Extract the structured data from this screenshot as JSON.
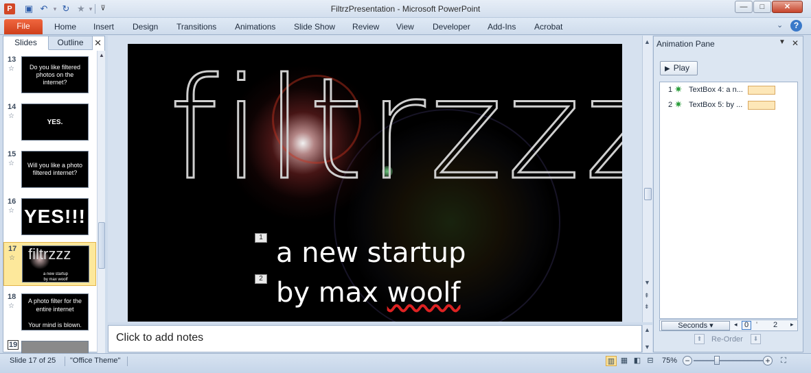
{
  "window": {
    "title": "FiltrzPresentation - Microsoft PowerPoint",
    "app_icon": "P",
    "qat": {
      "save": "save-icon",
      "undo": "undo-icon",
      "redo": "redo-icon",
      "star": "star-icon",
      "customize": "customize-qat-icon"
    },
    "controls": {
      "minimize": "—",
      "maximize": "□",
      "close": "✕"
    }
  },
  "ribbon": {
    "file_label": "File",
    "tabs": [
      "Home",
      "Insert",
      "Design",
      "Transitions",
      "Animations",
      "Slide Show",
      "Review",
      "View",
      "Developer",
      "Add-Ins",
      "Acrobat"
    ],
    "help": "?",
    "collapse": "♡"
  },
  "slides_panel": {
    "tab_slides": "Slides",
    "tab_outline": "Outline",
    "close": "✕",
    "thumbs": [
      {
        "num": "13",
        "text": "Do you like filtered photos on the internet?"
      },
      {
        "num": "14",
        "text": "YES."
      },
      {
        "num": "15",
        "text": "Will you like a photo filtered internet?"
      },
      {
        "num": "16",
        "text": "YES!!!"
      },
      {
        "num": "17",
        "logo": "filtrzzz",
        "line1": "a new startup",
        "line2": "by max woolf"
      },
      {
        "num": "18",
        "text": "A photo filter for the entire internet",
        "text2": "Your mind is blown."
      },
      {
        "num": "19",
        "text": ""
      }
    ]
  },
  "slide": {
    "title": "filtrzzz",
    "line1": "a new startup",
    "line2_a": "by max ",
    "line2_b": "woolf",
    "tag1": "1",
    "tag2": "2"
  },
  "notes": {
    "placeholder": "Click to add notes"
  },
  "animation_pane": {
    "title": "Animation Pane",
    "play_label": "Play",
    "items": [
      {
        "num": "1",
        "name": "TextBox 4: a n..."
      },
      {
        "num": "2",
        "name": "TextBox 5: by ..."
      }
    ],
    "timeline": {
      "unit_label": "Seconds",
      "start": "0",
      "end": "2"
    },
    "reorder_label": "Re-Order"
  },
  "status": {
    "slide_info": "Slide 17 of 25",
    "theme": "\"Office Theme\"",
    "zoom": "75%",
    "zoom_level": 0.33
  }
}
